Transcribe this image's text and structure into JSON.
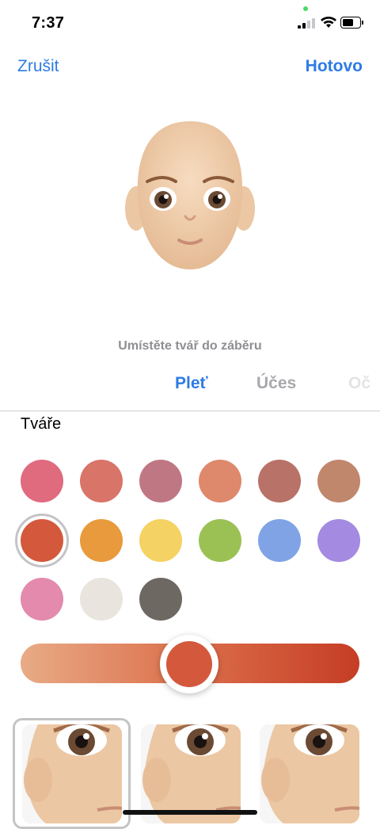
{
  "status_bar": {
    "time": "7:37",
    "privacy_dot_color": "#4cd964"
  },
  "nav": {
    "cancel_label": "Zrušit",
    "done_label": "Hotovo"
  },
  "camera_hint": "Umístěte tvář do záběru",
  "tabs": [
    {
      "label": "Pleť",
      "selected": true
    },
    {
      "label": "Účes",
      "selected": false
    },
    {
      "label": "Oč",
      "selected": false
    }
  ],
  "section": {
    "title": "Tváře"
  },
  "cheek_colors": [
    "#e06b7e",
    "#d97468",
    "#c07784",
    "#de886c",
    "#b87268",
    "#c0876d",
    "#d4583c",
    "#e89a3c",
    "#f5d264",
    "#9bc155",
    "#7fa3e5",
    "#a48ae0",
    "#e38aad",
    "#e9e4dd",
    "#6e6863"
  ],
  "selected_color_index": 6,
  "intensity_slider": {
    "value": 0.5,
    "thumb_color": "#d4583c"
  },
  "face_presets": [
    {
      "name": "preset-1",
      "selected": true
    },
    {
      "name": "preset-2",
      "selected": false
    },
    {
      "name": "preset-3",
      "selected": false
    }
  ],
  "colors": {
    "accent": "#2d7be4",
    "muted_tab": "#a8a8ad",
    "hint_text": "#8e8e93"
  }
}
